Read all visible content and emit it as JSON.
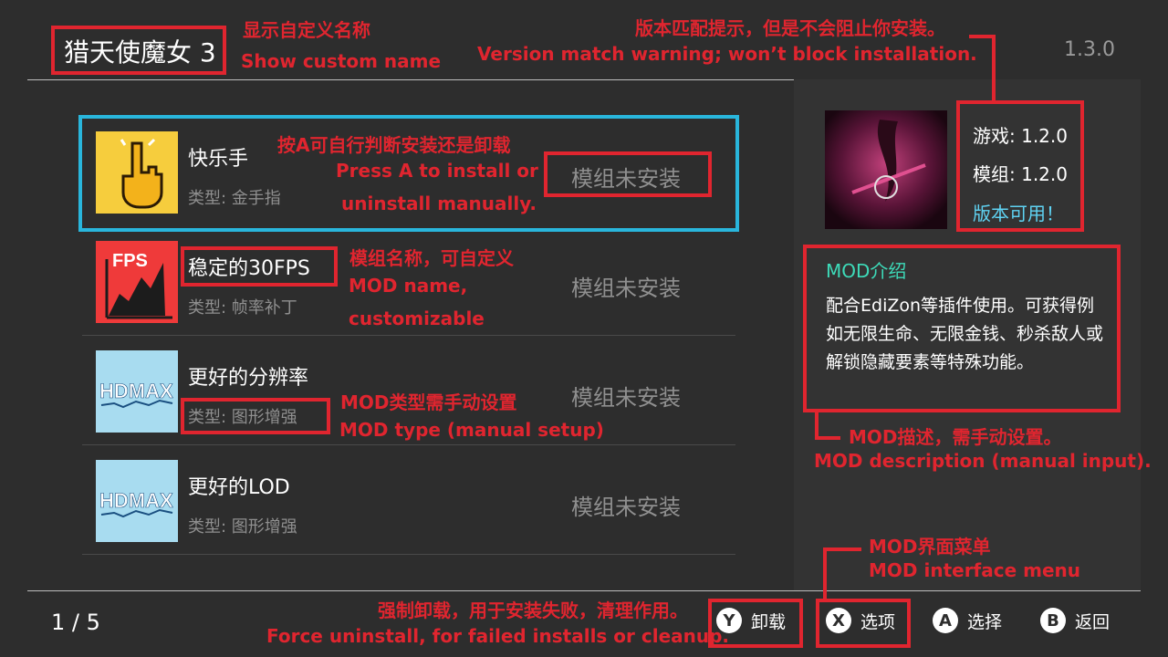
{
  "header": {
    "game_title": "猎天使魔女 3",
    "version": "1.3.0"
  },
  "mods": [
    {
      "name": "快乐手",
      "type": "类型: 金手指",
      "status": "模组未安装",
      "icon": "gold-finger-icon",
      "selected": true
    },
    {
      "name": "稳定的30FPS",
      "type": "类型: 帧率补丁",
      "status": "模组未安装",
      "icon": "fps-chart-icon",
      "icon_text": "FPS"
    },
    {
      "name": "更好的分辨率",
      "type": "类型: 图形增强",
      "status": "模组未安装",
      "icon": "hdmax-icon",
      "icon_text": "HDMAX"
    },
    {
      "name": "更好的LOD",
      "type": "类型: 图形增强",
      "status": "模组未安装",
      "icon": "hdmax-icon",
      "icon_text": "HDMAX"
    }
  ],
  "info": {
    "game_version": "游戏: 1.2.0",
    "mod_version": "模组: 1.2.0",
    "version_ok": "版本可用！"
  },
  "description": {
    "title": "MOD介绍",
    "text": "配合EdiZon等插件使用。可获得例如无限生命、无限金钱、秒杀敌人或解锁隐藏要素等特殊功能。"
  },
  "footer": {
    "page": "1 / 5",
    "buttons": [
      {
        "key": "Y",
        "label": "卸载"
      },
      {
        "key": "X",
        "label": "选项"
      },
      {
        "key": "A",
        "label": "选择"
      },
      {
        "key": "B",
        "label": "返回"
      }
    ]
  },
  "annotations": {
    "custom_name_cn": "显示自定义名称",
    "custom_name_en": "Show custom name",
    "version_warn_cn": "版本匹配提示，但是不会阻止你安装。",
    "version_warn_en": "Version match warning; won’t block installation.",
    "press_a_cn": "按A可自行判断安装还是卸载",
    "press_a_en1": "Press A to install or",
    "press_a_en2": "uninstall manually.",
    "mod_name_cn": "模组名称，可自定义",
    "mod_name_en1": "MOD name,",
    "mod_name_en2": "customizable",
    "mod_type_cn": "MOD类型需手动设置",
    "mod_type_en": "MOD type (manual setup)",
    "desc_cn": "MOD描述，需手动设置。",
    "desc_en": "MOD description (manual input).",
    "menu_cn": "MOD界面菜单",
    "menu_en": "MOD interface menu",
    "force_cn": "强制卸载，用于安装失败，清理作用。",
    "force_en": "Force uninstall, for failed installs or cleanup."
  },
  "colors": {
    "background": "#2d2d2d",
    "selection": "#29b6dc",
    "annotation": "#e0252f",
    "accent_teal": "#3ddbb9"
  }
}
